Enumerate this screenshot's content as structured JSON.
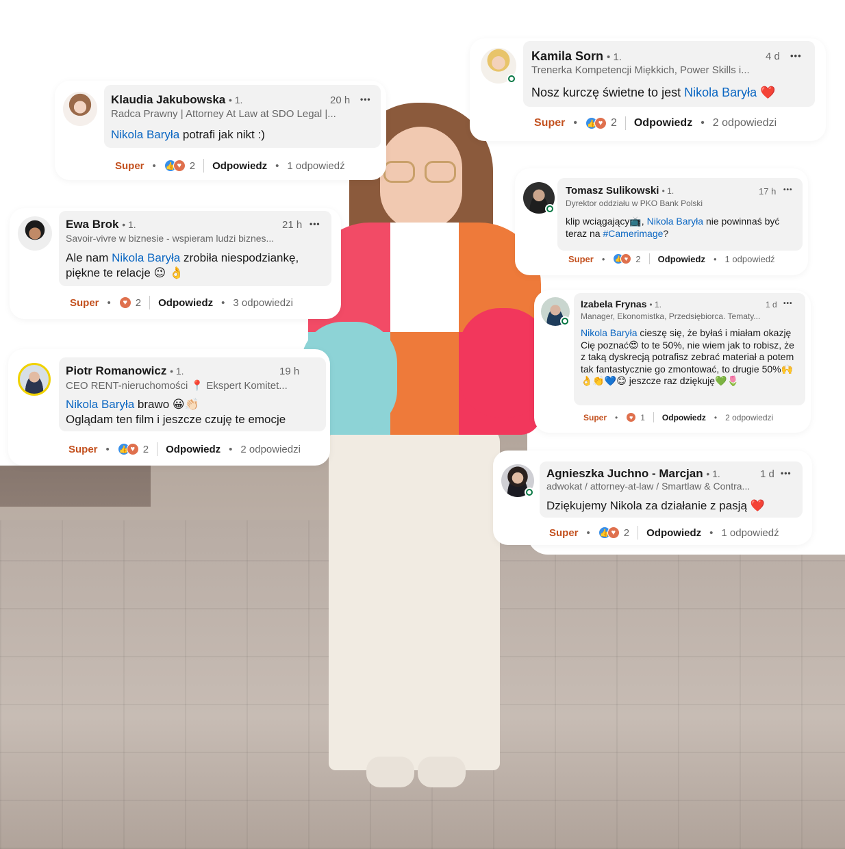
{
  "comments": [
    {
      "name": "Kamila Sorn",
      "degree": "• 1.",
      "time": "4 d",
      "more": "•••",
      "headline": "Trenerka Kompetencji Miękkich, Power Skills i...",
      "text_pre": "Nosz kurczę świetne to jest ",
      "mention": "Nikola Baryła",
      "text_post": " ❤️",
      "reaction_label": "Super",
      "reaction_count": "2",
      "reply_label": "Odpowiedz",
      "replies": "2 odpowiedzi"
    },
    {
      "name": "Klaudia Jakubowska",
      "degree": "• 1.",
      "time": "20 h",
      "more": "•••",
      "headline": "Radca Prawny | Attorney At Law at SDO Legal |...",
      "text_pre": "",
      "mention": "Nikola Baryła",
      "text_post": " potrafi jak nikt :)",
      "reaction_label": "Super",
      "reaction_count": "2",
      "reply_label": "Odpowiedz",
      "replies": "1 odpowiedź"
    },
    {
      "name": "Tomasz Sulikowski",
      "degree": "• 1.",
      "time": "17 h",
      "more": "•••",
      "headline": "Dyrektor oddziału w PKO Bank Polski",
      "text_pre": "klip wciągający📺,  ",
      "mention": "Nikola Baryła",
      "text_mid": " nie powinnaś być teraz na ",
      "hashtag": "#Camerimage",
      "text_post": "?",
      "reaction_label": "Super",
      "reaction_count": "2",
      "reply_label": "Odpowiedz",
      "replies": "1 odpowiedź"
    },
    {
      "name": "Ewa Brok",
      "degree": "• 1.",
      "time": "21 h",
      "more": "•••",
      "headline": "Savoir-vivre w biznesie - wspieram ludzi biznes...",
      "text_pre": "Ale nam ",
      "mention": "Nikola Baryła",
      "text_post": " zrobiła niespodziankę, piękne te relacje 😉 👌",
      "reaction_label": "Super",
      "reaction_count": "2",
      "reply_label": "Odpowiedz",
      "replies": "3 odpowiedzi"
    },
    {
      "name": "Izabela Frynas",
      "degree": "• 1.",
      "time": "1 d",
      "more": "•••",
      "headline": "Manager, Ekonomistka, Przedsiębiorca. Tematy...",
      "text_pre": "",
      "mention": "Nikola Baryła",
      "text_post": " cieszę się, że byłaś i miałam okazję Cię poznać😍 to te 50%,  nie wiem jak to robisz, że z taką dyskrecją potrafisz zebrać materiał a potem tak fantastycznie go zmontować, to drugie 50%🙌👌👏💙😊 jeszcze raz dziękuję💚🌷",
      "reaction_label": "Super",
      "reaction_count": "1",
      "reply_label": "Odpowiedz",
      "replies": "2 odpowiedzi"
    },
    {
      "name": "Piotr Romanowicz",
      "degree": "• 1.",
      "time": "19 h",
      "more": "•••",
      "headline": "CEO RENT-nieruchomości 📍 Ekspert Komitet...",
      "text_pre": "",
      "mention": "Nikola Baryła",
      "text_post": " brawo 😀👏🏻",
      "text_line2": "Oglądam ten film i jeszcze czuję te emocje",
      "reaction_label": "Super",
      "reaction_count": "2",
      "reply_label": "Odpowiedz",
      "replies": "2 odpowiedzi"
    },
    {
      "name": "Agnieszka Juchno - Marcjan",
      "degree": "• 1.",
      "time": "1 d",
      "more": "•••",
      "headline": "adwokat / attorney-at-law / Smartlaw & Contra...",
      "text_pre": "Dziękujemy Nikola za działanie z pasją ",
      "mention": "",
      "text_post": "❤️",
      "reaction_label": "Super",
      "reaction_count": "2",
      "reply_label": "Odpowiedz",
      "replies": "1 odpowiedź"
    }
  ],
  "icons": {
    "like": "like-icon",
    "love": "heart-icon",
    "more": "more-icon",
    "online": "online-status-icon"
  },
  "colors": {
    "mention": "#0a66c2",
    "super": "#c3511f",
    "bubble": "#f2f2f2",
    "online": "#057642"
  }
}
